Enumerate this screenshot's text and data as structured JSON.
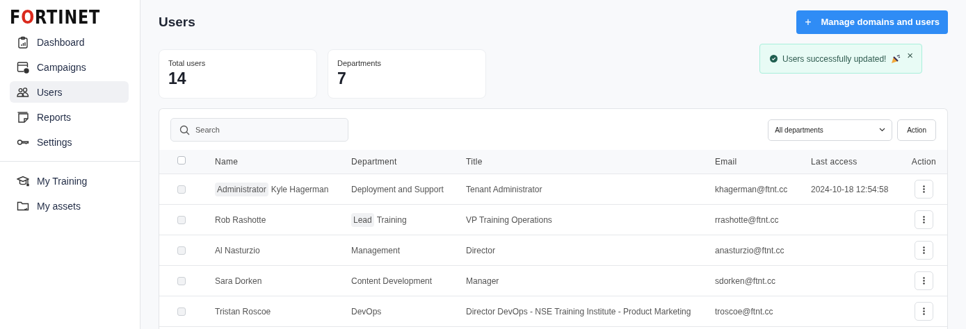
{
  "logo": "FORTINET",
  "sidebar": {
    "items": [
      {
        "label": "Dashboard",
        "selected": false
      },
      {
        "label": "Campaigns",
        "selected": false
      },
      {
        "label": "Users",
        "selected": true
      },
      {
        "label": "Reports",
        "selected": false
      },
      {
        "label": "Settings",
        "selected": false
      }
    ],
    "secondary_items": [
      {
        "label": "My Training",
        "selected": false
      },
      {
        "label": "My assets",
        "selected": false
      }
    ]
  },
  "page_title": "Users",
  "primary_button": {
    "icon": "+",
    "label": "Manage domains and users"
  },
  "toast": {
    "message": "Users successfully updated!",
    "close": "×"
  },
  "stats": [
    {
      "label": "Total users",
      "value": "14"
    },
    {
      "label": "Departments",
      "value": "7"
    }
  ],
  "search": {
    "placeholder": "Search"
  },
  "department_filter": {
    "value": "All departments"
  },
  "action_button": "Action",
  "table": {
    "select_all_checked": false,
    "columns": [
      "Name",
      "Department",
      "Title",
      "Email",
      "Last access",
      "Action"
    ],
    "rows": [
      {
        "checked": false,
        "name": "Kyle Hagerman",
        "name_tag": "Administrator",
        "department": "Deployment and Support",
        "title": "Tenant Administrator",
        "email": "khagerman@ftnt.cc",
        "last_access": "2024-10-18 12:54:58"
      },
      {
        "checked": false,
        "name": "Rob Rashotte",
        "department": "Training",
        "department_tag": "Lead",
        "title": "VP Training Operations",
        "email": "rrashotte@ftnt.cc"
      },
      {
        "checked": false,
        "name": "Al Nasturzio",
        "department": "Management",
        "title": "Director",
        "email": "anasturzio@ftnt.cc"
      },
      {
        "checked": false,
        "name": "Sara Dorken",
        "department": "Content Development",
        "title": "Manager",
        "email": "sdorken@ftnt.cc"
      },
      {
        "checked": false,
        "name": "Tristan Roscoe",
        "department": "DevOps",
        "title": "Director DevOps - NSE Training Institute - Product Marketing",
        "email": "troscoe@ftnt.cc"
      }
    ]
  }
}
